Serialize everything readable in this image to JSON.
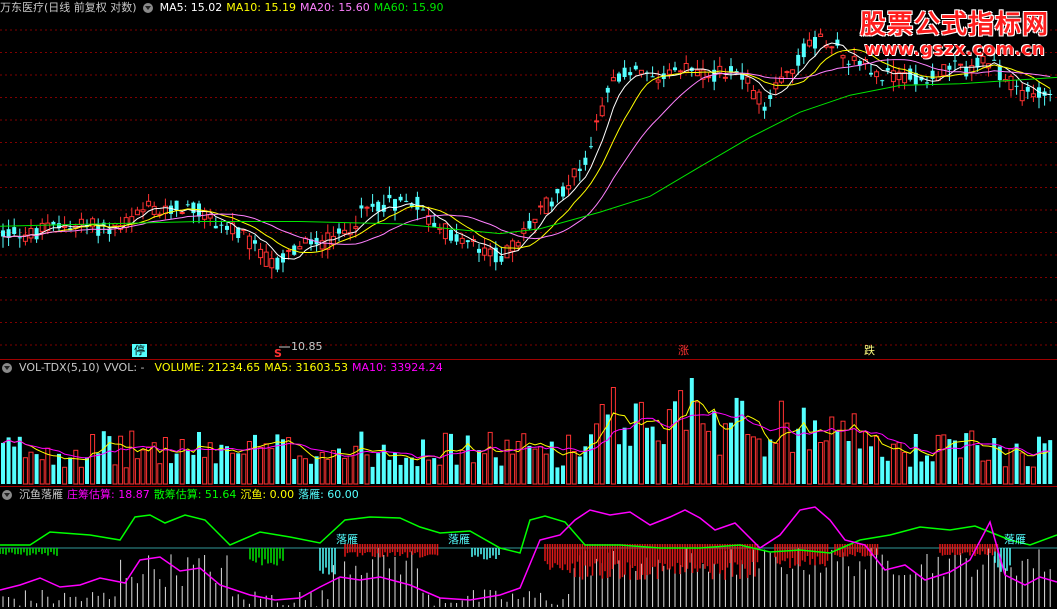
{
  "main_header": {
    "title": "万东医疗(日线 前复权 对数)",
    "ma5": "MA5: 15.02",
    "ma10": "MA10: 15.19",
    "ma20": "MA20: 15.60",
    "ma60": "MA60: 15.90"
  },
  "vol_header": {
    "name": "VOL-TDX(5,10)",
    "vvol": "VVOL: -",
    "volume": "VOLUME: 21234.65",
    "ma5": "MA5: 31603.53",
    "ma10": "MA10: 33924.24"
  },
  "ind_header": {
    "name": "沉鱼落雁",
    "zhuang": "庄筹估算: 18.87",
    "san": "散筹估算: 51.64",
    "chenyu": "沉鱼: 0.00",
    "luoyan": "落雁: 60.00"
  },
  "watermark": {
    "title": "股票公式指标网",
    "url": "www.gszx.com.cn"
  },
  "annotations": {
    "low_price": "10.85",
    "s_marker": "S",
    "signal_ting": "停",
    "signal_zhang": "涨",
    "signal_die": "跌",
    "luoyan_1": "落雁",
    "luoyan_2": "落雁",
    "luoyan_3": "落雁"
  },
  "colors": {
    "up": "#ff3232",
    "down": "#54ffff",
    "ma5": "#ffffff",
    "ma10": "#ffff00",
    "ma20": "#ff80ff",
    "ma60": "#00e600",
    "zhuang": "#ff00ff",
    "san": "#00ff00",
    "grid": "#800000"
  },
  "chart_data": {
    "type": "candlestick",
    "ylabel": "",
    "low_marker": 10.85,
    "price_path": [
      [
        0,
        14.4
      ],
      [
        15,
        14.5
      ],
      [
        30,
        14.3
      ],
      [
        50,
        14.6
      ],
      [
        70,
        14.8
      ],
      [
        90,
        14.7
      ],
      [
        110,
        14.6
      ],
      [
        130,
        14.9
      ],
      [
        150,
        15.5
      ],
      [
        165,
        15.2
      ],
      [
        180,
        15.6
      ],
      [
        200,
        15.3
      ],
      [
        215,
        14.9
      ],
      [
        230,
        14.6
      ],
      [
        245,
        14.2
      ],
      [
        260,
        13.6
      ],
      [
        275,
        13.1
      ],
      [
        285,
        13.5
      ],
      [
        300,
        13.9
      ],
      [
        315,
        14.0
      ],
      [
        330,
        14.1
      ],
      [
        345,
        14.4
      ],
      [
        360,
        15.2
      ],
      [
        375,
        15.6
      ],
      [
        390,
        15.7
      ],
      [
        405,
        15.7
      ],
      [
        415,
        15.9
      ],
      [
        425,
        15.1
      ],
      [
        440,
        14.7
      ],
      [
        455,
        14.2
      ],
      [
        470,
        14.0
      ],
      [
        485,
        13.6
      ],
      [
        500,
        13.5
      ],
      [
        515,
        13.9
      ],
      [
        525,
        14.5
      ],
      [
        540,
        15.3
      ],
      [
        555,
        16.0
      ],
      [
        570,
        16.7
      ],
      [
        585,
        17.7
      ],
      [
        595,
        19.2
      ],
      [
        605,
        21.0
      ],
      [
        615,
        22.2
      ],
      [
        625,
        22.6
      ],
      [
        640,
        22.7
      ],
      [
        655,
        21.8
      ],
      [
        670,
        22.4
      ],
      [
        685,
        23.0
      ],
      [
        700,
        22.8
      ],
      [
        715,
        22.4
      ],
      [
        730,
        23.0
      ],
      [
        745,
        22.2
      ],
      [
        755,
        21.5
      ],
      [
        765,
        20.7
      ],
      [
        775,
        21.9
      ],
      [
        790,
        22.9
      ],
      [
        805,
        24.3
      ],
      [
        815,
        24.7
      ],
      [
        830,
        25.1
      ],
      [
        845,
        23.9
      ],
      [
        860,
        23.4
      ],
      [
        875,
        22.6
      ],
      [
        890,
        22.5
      ],
      [
        905,
        22.6
      ],
      [
        920,
        22.3
      ],
      [
        935,
        22.6
      ],
      [
        950,
        23.0
      ],
      [
        965,
        22.9
      ],
      [
        980,
        23.3
      ],
      [
        995,
        23.0
      ],
      [
        1010,
        22.0
      ],
      [
        1025,
        21.3
      ],
      [
        1040,
        21.7
      ],
      [
        1057,
        21.1
      ]
    ],
    "ma60_path": [
      [
        0,
        14.7
      ],
      [
        100,
        14.8
      ],
      [
        200,
        14.9
      ],
      [
        300,
        14.9
      ],
      [
        400,
        14.8
      ],
      [
        450,
        14.6
      ],
      [
        500,
        14.4
      ],
      [
        540,
        14.6
      ],
      [
        600,
        15.3
      ],
      [
        650,
        16.0
      ],
      [
        700,
        17.4
      ],
      [
        750,
        18.9
      ],
      [
        800,
        20.3
      ],
      [
        850,
        21.3
      ],
      [
        900,
        21.9
      ],
      [
        960,
        22.0
      ],
      [
        1057,
        22.4
      ]
    ]
  }
}
